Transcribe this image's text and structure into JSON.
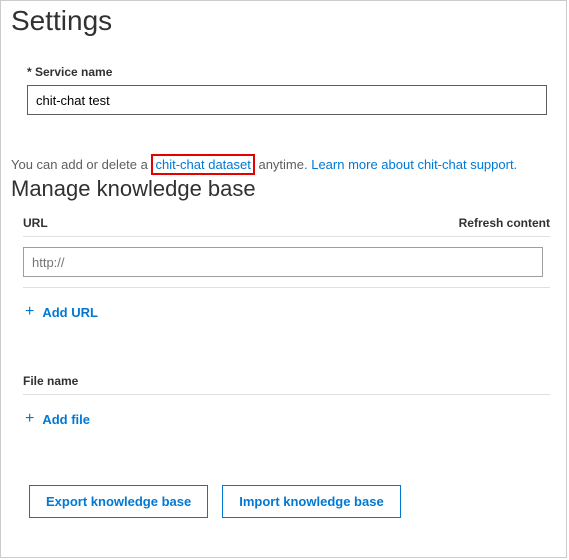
{
  "page_title": "Settings",
  "service_name": {
    "label": "* Service name",
    "value": "chit-chat test"
  },
  "hint": {
    "prefix": "You can add or delete a ",
    "highlighted_link": "chit-chat dataset",
    "mid": " anytime. ",
    "learn_more": "Learn more about chit-chat support."
  },
  "manage": {
    "heading": "Manage knowledge base",
    "url_label": "URL",
    "refresh_label": "Refresh content",
    "url_placeholder": "http://",
    "add_url": "Add URL",
    "file_label": "File name",
    "add_file": "Add file"
  },
  "buttons": {
    "export": "Export knowledge base",
    "import": "Import knowledge base"
  }
}
